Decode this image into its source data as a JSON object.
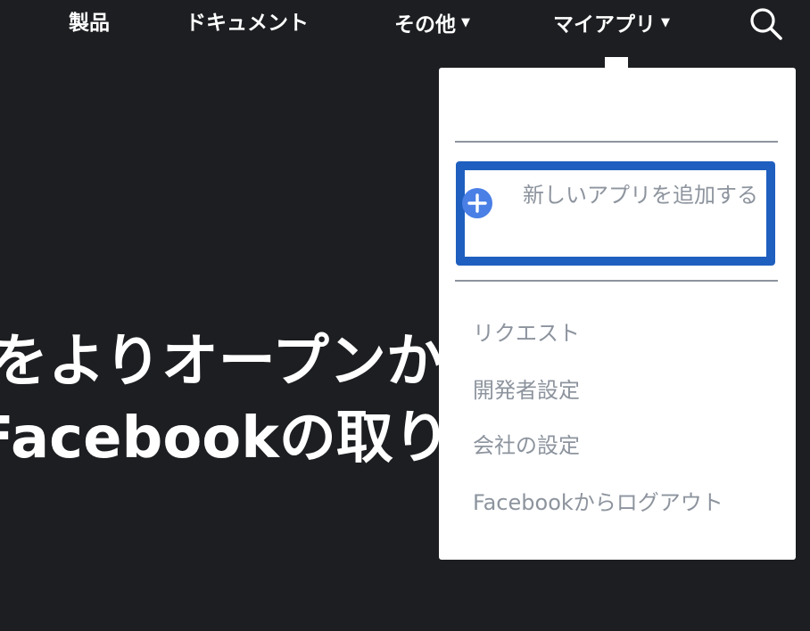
{
  "nav": {
    "products": "製品",
    "docs": "ドキュメント",
    "other": "その他",
    "other_caret": "▼",
    "my_apps": "マイアプリ",
    "my_apps_caret": "▼"
  },
  "hero": {
    "line1": "をよりオープンかつ",
    "line2": "Facebookの取り組み"
  },
  "dropdown": {
    "add_app": "新しいアプリを追加する",
    "items": [
      "リクエスト",
      "開発者設定",
      "会社の設定",
      "Facebookからログアウト"
    ]
  },
  "colors": {
    "background": "#1c1e21",
    "highlight": "#1f5fbf",
    "plus_icon": "#4a7fe6",
    "menu_text": "#8d949e"
  }
}
